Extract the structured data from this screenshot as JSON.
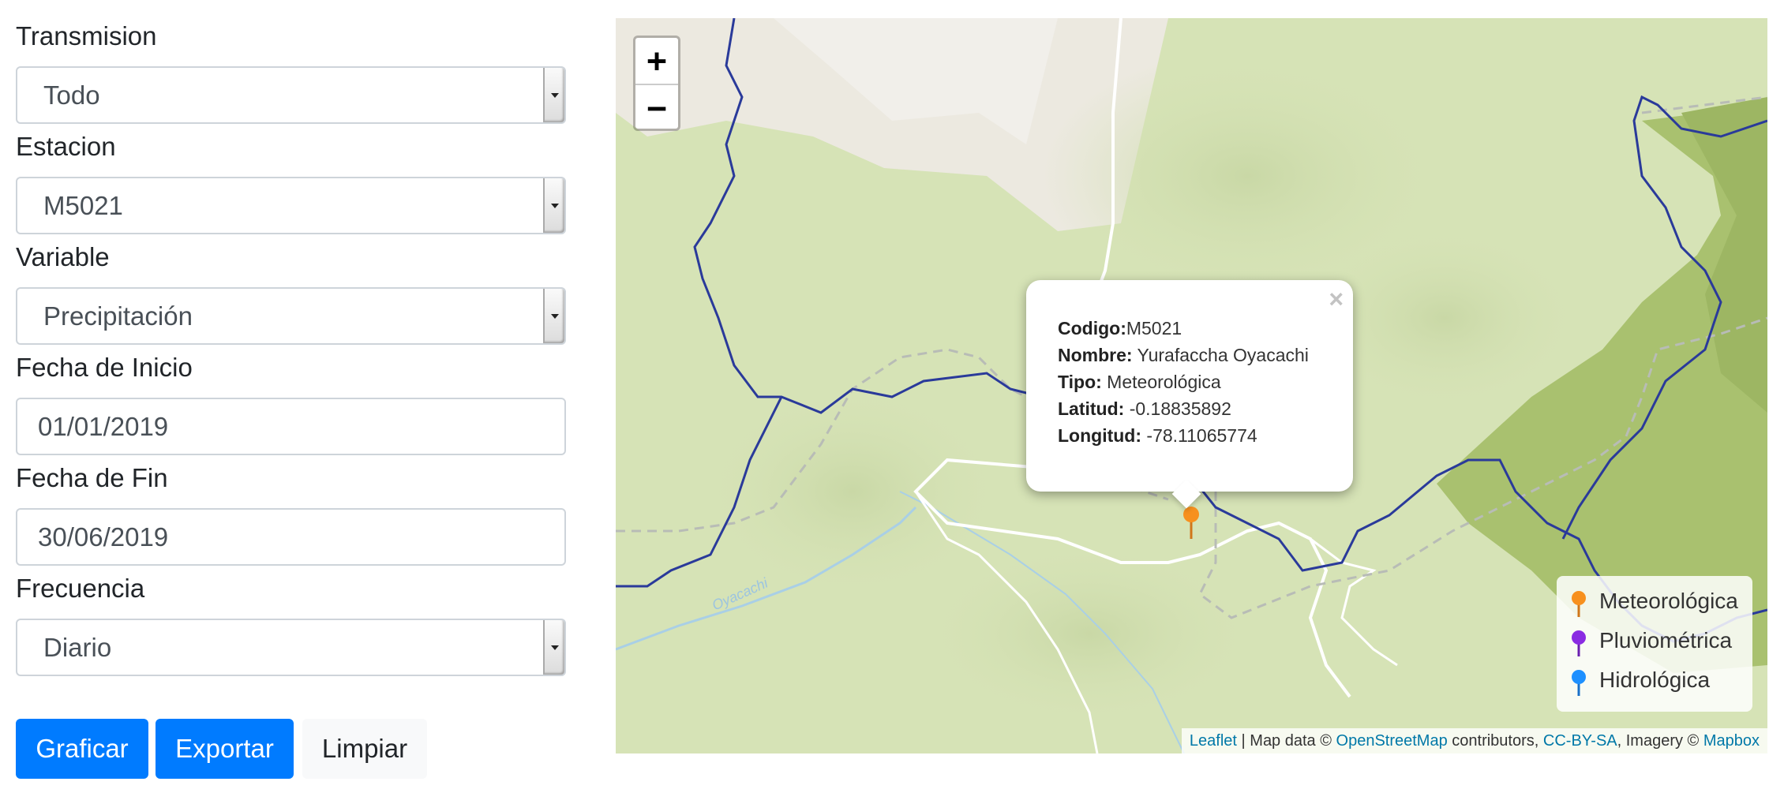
{
  "form": {
    "transmision": {
      "label": "Transmision",
      "value": "Todo"
    },
    "estacion": {
      "label": "Estacion",
      "value": "M5021"
    },
    "variable": {
      "label": "Variable",
      "value": "Precipitación"
    },
    "fecha_inicio": {
      "label": "Fecha de Inicio",
      "value": "01/01/2019"
    },
    "fecha_fin": {
      "label": "Fecha de Fin",
      "value": "30/06/2019"
    },
    "frecuencia": {
      "label": "Frecuencia",
      "value": "Diario"
    }
  },
  "buttons": {
    "graficar": "Graficar",
    "exportar": "Exportar",
    "limpiar": "Limpiar"
  },
  "map": {
    "zoom_in": "+",
    "zoom_out": "−",
    "river_label": "Oyacachi",
    "popup": {
      "close": "×",
      "codigo_key": "Codigo:",
      "codigo_val": "M5021",
      "nombre_key": "Nombre:",
      "nombre_val": " Yurafaccha Oyacachi",
      "tipo_key": "Tipo:",
      "tipo_val": " Meteorológica",
      "latitud_key": "Latitud:",
      "latitud_val": " -0.18835892",
      "longitud_key": "Longitud:",
      "longitud_val": " -78.11065774"
    },
    "legend": [
      {
        "label": "Meteorológica",
        "color": "#f7901e"
      },
      {
        "label": "Pluviométrica",
        "color": "#8a2be2"
      },
      {
        "label": "Hidrológica",
        "color": "#1e90ff"
      }
    ],
    "attribution": {
      "leaflet": "Leaflet",
      "sep1": " | Map data © ",
      "osm": "OpenStreetMap",
      "sep2": " contributors, ",
      "license": "CC-BY-SA",
      "sep3": ", Imagery © ",
      "mapbox": "Mapbox"
    },
    "marker_color": "#f7901e"
  }
}
